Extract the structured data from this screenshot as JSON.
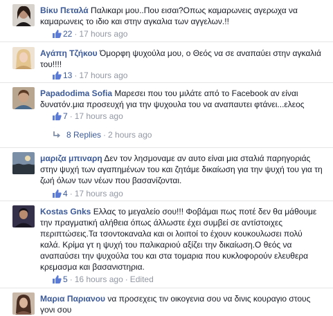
{
  "colors": {
    "link": "#3b5998",
    "meta": "#9197a3",
    "text": "#141823",
    "divider": "#e5e5e5"
  },
  "comments": [
    {
      "author": "Βίκυ Πεταλά",
      "text": "Παλικαρι μου..Που εισαι?Οπως καμαρωνεις αγερωχα να καμαρωνεις το ιδιο και στην αγκαλια των αγγελων.!!",
      "likes": "22",
      "time": "17 hours ago",
      "edited": ""
    },
    {
      "author": "Αγάπη Τζήκου",
      "text": "Όμορφη ψυχούλα μου, ο Θεός να σε αναπαύει στην αγκαλιά του!!!!",
      "likes": "13",
      "time": "17 hours ago",
      "edited": ""
    },
    {
      "author": "Papadodima Sofia",
      "text": "Μαρεσει που του μιλάτε από το Facebook αν είναι δυνατόν.μια προσευχή για την ψυχουλα του να αναπαυτει φτάνει...ελεος",
      "likes": "7",
      "time": "17 hours ago",
      "edited": "",
      "replies_label": "8 Replies",
      "replies_time": "2 hours ago"
    },
    {
      "author": "μαριζα μπιναρη",
      "text": "Δεν τον λησμοναμε αν αυτο είναι μια σταλιά παρηγοριάς στην ψυχή των αγαπημένων του και ζητάμε δικαίωση για την ψυχή του για τη ζωή όλων των νέων που βασανίζονται.",
      "likes": "4",
      "time": "17 hours ago",
      "edited": ""
    },
    {
      "author": "Kostas Gnks",
      "text": "Ελλας το μεγαλείο σου!!! Φοβάμαι πως ποτέ δεν θα μάθουμε την πραγματική αλήθεια όπως άλλωστε έχει συμβεί σε αντίστοιχες περιπτώσεις.Τα τσοντοκαναλα και οι λοιποί το έχουν κουκουλωσει πολύ καλά. Κρίμα γτ η ψυχή του παλικαριού αξίζει την δικαίωση.Ο θεός να αναπαύσει την ψυχούλα του και στα τομαρια που κυκλοφορούν ελευθερα κρεμασμα και βασανιστηρια.",
      "likes": "5",
      "time": "16 hours ago",
      "edited": "Edited"
    },
    {
      "author": "Μαρια Παριανου",
      "text": "να προσεχεις τιν οικογενια σου να δινις κουραγιο στους γονι σου",
      "likes": "",
      "time": "",
      "edited": ""
    }
  ]
}
